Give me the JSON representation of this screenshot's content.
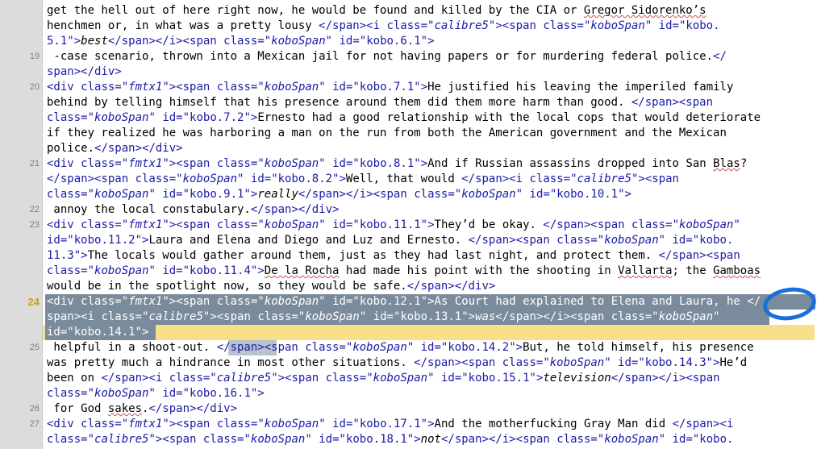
{
  "editor": {
    "current_line": "24",
    "gutter": [
      {
        "row": 3,
        "label": "19"
      },
      {
        "row": 5,
        "label": "20"
      },
      {
        "row": 10,
        "label": "21"
      },
      {
        "row": 13,
        "label": "22"
      },
      {
        "row": 14,
        "label": "23"
      },
      {
        "row": 19,
        "label": "24",
        "current": true
      },
      {
        "row": 22,
        "label": "25"
      },
      {
        "row": 26,
        "label": "26"
      },
      {
        "row": 27,
        "label": "27"
      }
    ],
    "lines": [
      [
        [
          "t",
          "get the hell out of here right now, he would be found and killed by the CIA or "
        ],
        [
          "s",
          "Gregor Sidorenko’s"
        ]
      ],
      [
        [
          "t",
          "henchmen or, in what was a pretty lousy "
        ],
        [
          "g",
          "</span><i "
        ],
        [
          "a",
          "class="
        ],
        [
          "v",
          "\""
        ],
        [
          "c",
          "calibre5"
        ],
        [
          "v",
          "\""
        ],
        [
          "g",
          "><span "
        ],
        [
          "a",
          "class="
        ],
        [
          "v",
          "\""
        ],
        [
          "c",
          "koboSpan"
        ],
        [
          "v",
          "\""
        ],
        [
          "a",
          " id="
        ],
        [
          "v",
          "\"kobo."
        ]
      ],
      [
        [
          "v",
          "5.1\""
        ],
        [
          "g",
          ">"
        ],
        [
          "i",
          "best"
        ],
        [
          "g",
          "</span></i><span "
        ],
        [
          "a",
          "class="
        ],
        [
          "v",
          "\""
        ],
        [
          "c",
          "koboSpan"
        ],
        [
          "v",
          "\""
        ],
        [
          "a",
          " id="
        ],
        [
          "v",
          "\"kobo.6.1\""
        ],
        [
          "g",
          ">"
        ]
      ],
      [
        [
          "t",
          " -case scenario, thrown into a Mexican jail for not having papers or for murdering federal police."
        ],
        [
          "g",
          "</"
        ]
      ],
      [
        [
          "g",
          "span></div>"
        ]
      ],
      [
        [
          "g",
          "<div "
        ],
        [
          "a",
          "class="
        ],
        [
          "v",
          "\""
        ],
        [
          "c",
          "fmtx1"
        ],
        [
          "v",
          "\""
        ],
        [
          "g",
          "><span "
        ],
        [
          "a",
          "class="
        ],
        [
          "v",
          "\""
        ],
        [
          "c",
          "koboSpan"
        ],
        [
          "v",
          "\""
        ],
        [
          "a",
          " id="
        ],
        [
          "v",
          "\"kobo.7.1\""
        ],
        [
          "g",
          ">"
        ],
        [
          "t",
          "He justified his leaving the imperiled family"
        ]
      ],
      [
        [
          "t",
          "behind by telling himself that his presence around them did them more harm than good. "
        ],
        [
          "g",
          "</span><span"
        ]
      ],
      [
        [
          "a",
          "class="
        ],
        [
          "v",
          "\""
        ],
        [
          "c",
          "koboSpan"
        ],
        [
          "v",
          "\""
        ],
        [
          "a",
          " id="
        ],
        [
          "v",
          "\"kobo.7.2\""
        ],
        [
          "g",
          ">"
        ],
        [
          "t",
          "Ernesto had a good relationship with the local cops that would deteriorate"
        ]
      ],
      [
        [
          "t",
          "if they realized he was harboring a man on the run from both the American government and the Mexican"
        ]
      ],
      [
        [
          "t",
          "police."
        ],
        [
          "g",
          "</span></div>"
        ]
      ],
      [
        [
          "g",
          "<div "
        ],
        [
          "a",
          "class="
        ],
        [
          "v",
          "\""
        ],
        [
          "c",
          "fmtx1"
        ],
        [
          "v",
          "\""
        ],
        [
          "g",
          "><span "
        ],
        [
          "a",
          "class="
        ],
        [
          "v",
          "\""
        ],
        [
          "c",
          "koboSpan"
        ],
        [
          "v",
          "\""
        ],
        [
          "a",
          " id="
        ],
        [
          "v",
          "\"kobo.8.1\""
        ],
        [
          "g",
          ">"
        ],
        [
          "t",
          "And if Russian assassins dropped into San "
        ],
        [
          "s",
          "Blas"
        ],
        [
          "t",
          "?"
        ]
      ],
      [
        [
          "g",
          "</span><span "
        ],
        [
          "a",
          "class="
        ],
        [
          "v",
          "\""
        ],
        [
          "c",
          "koboSpan"
        ],
        [
          "v",
          "\""
        ],
        [
          "a",
          " id="
        ],
        [
          "v",
          "\"kobo.8.2\""
        ],
        [
          "g",
          ">"
        ],
        [
          "t",
          "Well, that would "
        ],
        [
          "g",
          "</span><i "
        ],
        [
          "a",
          "class="
        ],
        [
          "v",
          "\""
        ],
        [
          "c",
          "calibre5"
        ],
        [
          "v",
          "\""
        ],
        [
          "g",
          "><span"
        ]
      ],
      [
        [
          "a",
          "class="
        ],
        [
          "v",
          "\""
        ],
        [
          "c",
          "koboSpan"
        ],
        [
          "v",
          "\""
        ],
        [
          "a",
          " id="
        ],
        [
          "v",
          "\"kobo.9.1\""
        ],
        [
          "g",
          ">"
        ],
        [
          "i",
          "really"
        ],
        [
          "g",
          "</span></i><span "
        ],
        [
          "a",
          "class="
        ],
        [
          "v",
          "\""
        ],
        [
          "c",
          "koboSpan"
        ],
        [
          "v",
          "\""
        ],
        [
          "a",
          " id="
        ],
        [
          "v",
          "\"kobo.10.1\""
        ],
        [
          "g",
          ">"
        ]
      ],
      [
        [
          "t",
          " annoy the local constabulary."
        ],
        [
          "g",
          "</span></div>"
        ]
      ],
      [
        [
          "g",
          "<div "
        ],
        [
          "a",
          "class="
        ],
        [
          "v",
          "\""
        ],
        [
          "c",
          "fmtx1"
        ],
        [
          "v",
          "\""
        ],
        [
          "g",
          "><span "
        ],
        [
          "a",
          "class="
        ],
        [
          "v",
          "\""
        ],
        [
          "c",
          "koboSpan"
        ],
        [
          "v",
          "\""
        ],
        [
          "a",
          " id="
        ],
        [
          "v",
          "\"kobo.11.1\""
        ],
        [
          "g",
          ">"
        ],
        [
          "t",
          "They’d be okay. "
        ],
        [
          "g",
          "</span><span "
        ],
        [
          "a",
          "class="
        ],
        [
          "v",
          "\""
        ],
        [
          "c",
          "koboSpan"
        ],
        [
          "v",
          "\""
        ]
      ],
      [
        [
          "a",
          "id="
        ],
        [
          "v",
          "\"kobo.11.2\""
        ],
        [
          "g",
          ">"
        ],
        [
          "t",
          "Laura and Elena and Diego and Luz and Ernesto. "
        ],
        [
          "g",
          "</span><span "
        ],
        [
          "a",
          "class="
        ],
        [
          "v",
          "\""
        ],
        [
          "c",
          "koboSpan"
        ],
        [
          "v",
          "\""
        ],
        [
          "a",
          " id="
        ],
        [
          "v",
          "\"kobo."
        ]
      ],
      [
        [
          "v",
          "11.3\""
        ],
        [
          "g",
          ">"
        ],
        [
          "t",
          "The locals would gather around them, just as they had last night, and protect them. "
        ],
        [
          "g",
          "</span><span"
        ]
      ],
      [
        [
          "a",
          "class="
        ],
        [
          "v",
          "\""
        ],
        [
          "c",
          "koboSpan"
        ],
        [
          "v",
          "\""
        ],
        [
          "a",
          " id="
        ],
        [
          "v",
          "\"kobo.11.4\""
        ],
        [
          "g",
          ">"
        ],
        [
          "s",
          "De la Rocha"
        ],
        [
          "t",
          " had made his point with the shooting in "
        ],
        [
          "s",
          "Vallarta"
        ],
        [
          "t",
          "; the "
        ],
        [
          "s",
          "Gamboas"
        ]
      ],
      [
        [
          "t",
          "would be in the spotlight now, so they would be safe."
        ],
        [
          "g",
          "</span></div>"
        ]
      ],
      [
        [
          "g",
          "<div "
        ],
        [
          "a",
          "class="
        ],
        [
          "v",
          "\""
        ],
        [
          "c",
          "fmtx1"
        ],
        [
          "v",
          "\""
        ],
        [
          "g",
          "><span "
        ],
        [
          "a",
          "class="
        ],
        [
          "v",
          "\""
        ],
        [
          "c",
          "koboSpan"
        ],
        [
          "v",
          "\""
        ],
        [
          "a",
          " id="
        ],
        [
          "v",
          "\"kobo.12.1\""
        ],
        [
          "g",
          ">"
        ],
        [
          "t",
          "As Court had explained to Elena and Laura, he "
        ],
        [
          "g",
          "</"
        ]
      ],
      [
        [
          "g",
          "span><i "
        ],
        [
          "a",
          "class="
        ],
        [
          "v",
          "\""
        ],
        [
          "c",
          "calibre5"
        ],
        [
          "v",
          "\""
        ],
        [
          "g",
          "><span "
        ],
        [
          "a",
          "class="
        ],
        [
          "v",
          "\""
        ],
        [
          "c",
          "koboSpan"
        ],
        [
          "v",
          "\""
        ],
        [
          "a",
          " id="
        ],
        [
          "v",
          "\"kobo.13.1\""
        ],
        [
          "g",
          ">"
        ],
        [
          "i",
          "was"
        ],
        [
          "g",
          "</span></i><span "
        ],
        [
          "a",
          "class="
        ],
        [
          "v",
          "\""
        ],
        [
          "c",
          "koboSpan"
        ],
        [
          "v",
          "\""
        ]
      ],
      [
        [
          "a",
          "id="
        ],
        [
          "v",
          "\"kobo.14.1\""
        ],
        [
          "g",
          ">"
        ]
      ],
      [
        [
          "t",
          " helpful in a shoot-out. "
        ],
        [
          "g",
          "</span><span "
        ],
        [
          "a",
          "class="
        ],
        [
          "v",
          "\""
        ],
        [
          "c",
          "koboSpan"
        ],
        [
          "v",
          "\""
        ],
        [
          "a",
          " id="
        ],
        [
          "v",
          "\"kobo.14.2\""
        ],
        [
          "g",
          ">"
        ],
        [
          "t",
          "But, he told himself, his presence"
        ]
      ],
      [
        [
          "t",
          "was pretty much a hindrance in most other situations. "
        ],
        [
          "g",
          "</span><span "
        ],
        [
          "a",
          "class="
        ],
        [
          "v",
          "\""
        ],
        [
          "c",
          "koboSpan"
        ],
        [
          "v",
          "\""
        ],
        [
          "a",
          " id="
        ],
        [
          "v",
          "\"kobo.14.3\""
        ],
        [
          "g",
          ">"
        ],
        [
          "t",
          "He’d"
        ]
      ],
      [
        [
          "t",
          "been on "
        ],
        [
          "g",
          "</span><i "
        ],
        [
          "a",
          "class="
        ],
        [
          "v",
          "\""
        ],
        [
          "c",
          "calibre5"
        ],
        [
          "v",
          "\""
        ],
        [
          "g",
          "><span "
        ],
        [
          "a",
          "class="
        ],
        [
          "v",
          "\""
        ],
        [
          "c",
          "koboSpan"
        ],
        [
          "v",
          "\""
        ],
        [
          "a",
          " id="
        ],
        [
          "v",
          "\"kobo.15.1\""
        ],
        [
          "g",
          ">"
        ],
        [
          "i",
          "television"
        ],
        [
          "g",
          "</span></i><span"
        ]
      ],
      [
        [
          "a",
          "class="
        ],
        [
          "v",
          "\""
        ],
        [
          "c",
          "koboSpan"
        ],
        [
          "v",
          "\""
        ],
        [
          "a",
          " id="
        ],
        [
          "v",
          "\"kobo.16.1\""
        ],
        [
          "g",
          ">"
        ]
      ],
      [
        [
          "t",
          " for God "
        ],
        [
          "s",
          "sakes"
        ],
        [
          "t",
          "."
        ],
        [
          "g",
          "</span></div>"
        ]
      ],
      [
        [
          "g",
          "<div "
        ],
        [
          "a",
          "class="
        ],
        [
          "v",
          "\""
        ],
        [
          "c",
          "fmtx1"
        ],
        [
          "v",
          "\""
        ],
        [
          "g",
          "><span "
        ],
        [
          "a",
          "class="
        ],
        [
          "v",
          "\""
        ],
        [
          "c",
          "koboSpan"
        ],
        [
          "v",
          "\""
        ],
        [
          "a",
          " id="
        ],
        [
          "v",
          "\"kobo.17.1\""
        ],
        [
          "g",
          ">"
        ],
        [
          "t",
          "And the motherfucking Gray Man did "
        ],
        [
          "g",
          "</span><i"
        ]
      ],
      [
        [
          "a",
          "class="
        ],
        [
          "v",
          "\""
        ],
        [
          "c",
          "calibre5"
        ],
        [
          "v",
          "\""
        ],
        [
          "g",
          "><span "
        ],
        [
          "a",
          "class="
        ],
        [
          "v",
          "\""
        ],
        [
          "c",
          "koboSpan"
        ],
        [
          "v",
          "\""
        ],
        [
          "a",
          " id="
        ],
        [
          "v",
          "\"kobo.18.1\""
        ],
        [
          "g",
          ">"
        ],
        [
          "i",
          "not"
        ],
        [
          "g",
          "</span></i><span "
        ],
        [
          "a",
          "class="
        ],
        [
          "v",
          "\""
        ],
        [
          "c",
          "koboSpan"
        ],
        [
          "v",
          "\""
        ],
        [
          "a",
          " id="
        ],
        [
          "v",
          "\"kobo."
        ]
      ]
    ]
  },
  "colors": {
    "annotation_circle": "#1a6fd8",
    "selection": "#7a8b9c",
    "current_line": "#f8e08a"
  }
}
